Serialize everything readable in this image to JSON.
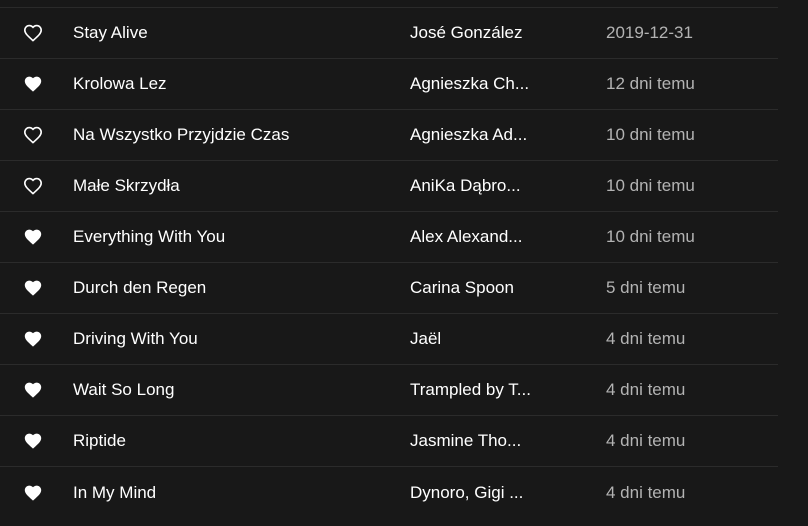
{
  "colors": {
    "background": "#181818",
    "divider": "#2b2b2b",
    "text_primary": "#ffffff",
    "text_secondary": "#b3b3b3"
  },
  "icons": {
    "liked": "heart-filled-icon",
    "not_liked": "heart-outline-icon"
  },
  "tracks": [
    {
      "title": "Stay Alive",
      "artist": "José González",
      "added": "2019-12-31",
      "liked": false
    },
    {
      "title": "Krolowa Lez",
      "artist": "Agnieszka Ch...",
      "added": "12 dni temu",
      "liked": true
    },
    {
      "title": "Na Wszystko Przyjdzie Czas",
      "artist": "Agnieszka Ad...",
      "added": "10 dni temu",
      "liked": false
    },
    {
      "title": "Małe Skrzydła",
      "artist": "AniKa Dąbro...",
      "added": "10 dni temu",
      "liked": false
    },
    {
      "title": "Everything With You",
      "artist": "Alex Alexand...",
      "added": "10 dni temu",
      "liked": true
    },
    {
      "title": "Durch den Regen",
      "artist": "Carina Spoon",
      "added": "5 dni temu",
      "liked": true
    },
    {
      "title": "Driving With You",
      "artist": "Jaël",
      "added": "4 dni temu",
      "liked": true
    },
    {
      "title": "Wait So Long",
      "artist": "Trampled by T...",
      "added": "4 dni temu",
      "liked": true
    },
    {
      "title": "Riptide",
      "artist": "Jasmine Tho...",
      "added": "4 dni temu",
      "liked": true
    },
    {
      "title": "In My Mind",
      "artist": "Dynoro, Gigi ...",
      "added": "4 dni temu",
      "liked": true
    }
  ]
}
